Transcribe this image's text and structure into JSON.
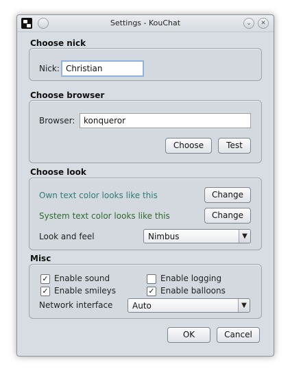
{
  "window": {
    "title": "Settings - KouChat"
  },
  "sections": {
    "nick": {
      "title": "Choose nick",
      "label": "Nick:",
      "value": "Christian"
    },
    "browser": {
      "title": "Choose browser",
      "label": "Browser:",
      "value": "konqueror",
      "choose_label": "Choose",
      "test_label": "Test"
    },
    "look": {
      "title": "Choose look",
      "own_text": "Own text color looks like this",
      "own_color": "#2f7a74",
      "system_text": "System text color looks like this",
      "system_color": "#2e6a2e",
      "change_label": "Change",
      "lookfeel_label": "Look and feel",
      "lookfeel_value": "Nimbus"
    },
    "misc": {
      "title": "Misc",
      "options": [
        {
          "label": "Enable sound",
          "checked": true
        },
        {
          "label": "Enable logging",
          "checked": false
        },
        {
          "label": "Enable smileys",
          "checked": true
        },
        {
          "label": "Enable balloons",
          "checked": true
        }
      ],
      "network_label": "Network interface",
      "network_value": "Auto"
    }
  },
  "footer": {
    "ok_label": "OK",
    "cancel_label": "Cancel"
  }
}
